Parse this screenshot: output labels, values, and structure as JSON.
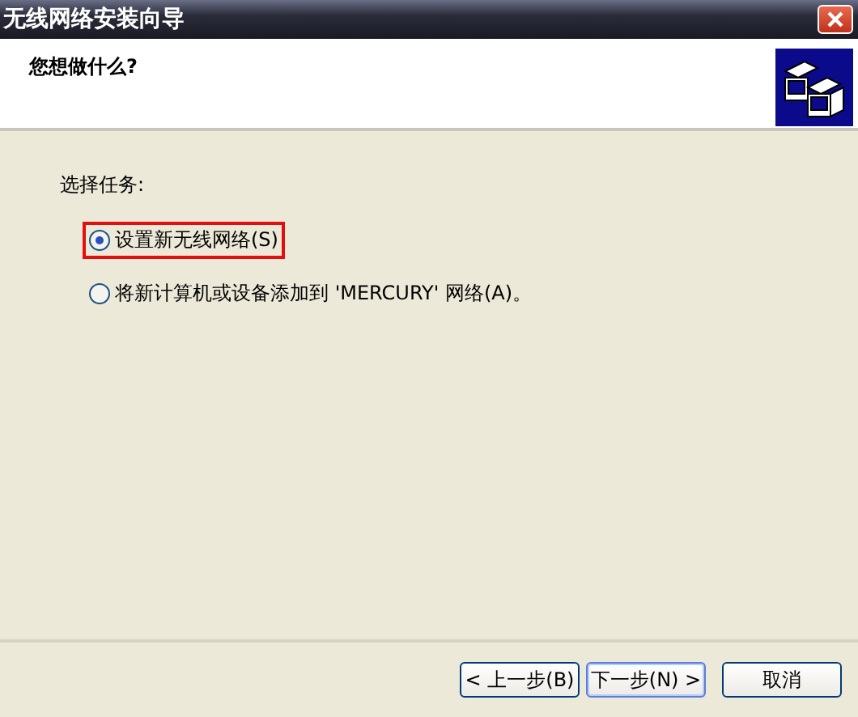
{
  "window": {
    "title": "无线网络安装向导"
  },
  "header": {
    "heading": "您想做什么?"
  },
  "task_label": "选择任务:",
  "options": [
    {
      "label": "设置新无线网络(S)",
      "selected": true,
      "highlighted": true
    },
    {
      "label": "将新计算机或设备添加到 'MERCURY' 网络(A)。",
      "selected": false,
      "highlighted": false
    }
  ],
  "buttons": [
    {
      "label": "< 上一步(B)",
      "kind": "back"
    },
    {
      "label": "下一步(N) >",
      "kind": "next"
    },
    {
      "label": "取消",
      "kind": "cancel"
    }
  ]
}
